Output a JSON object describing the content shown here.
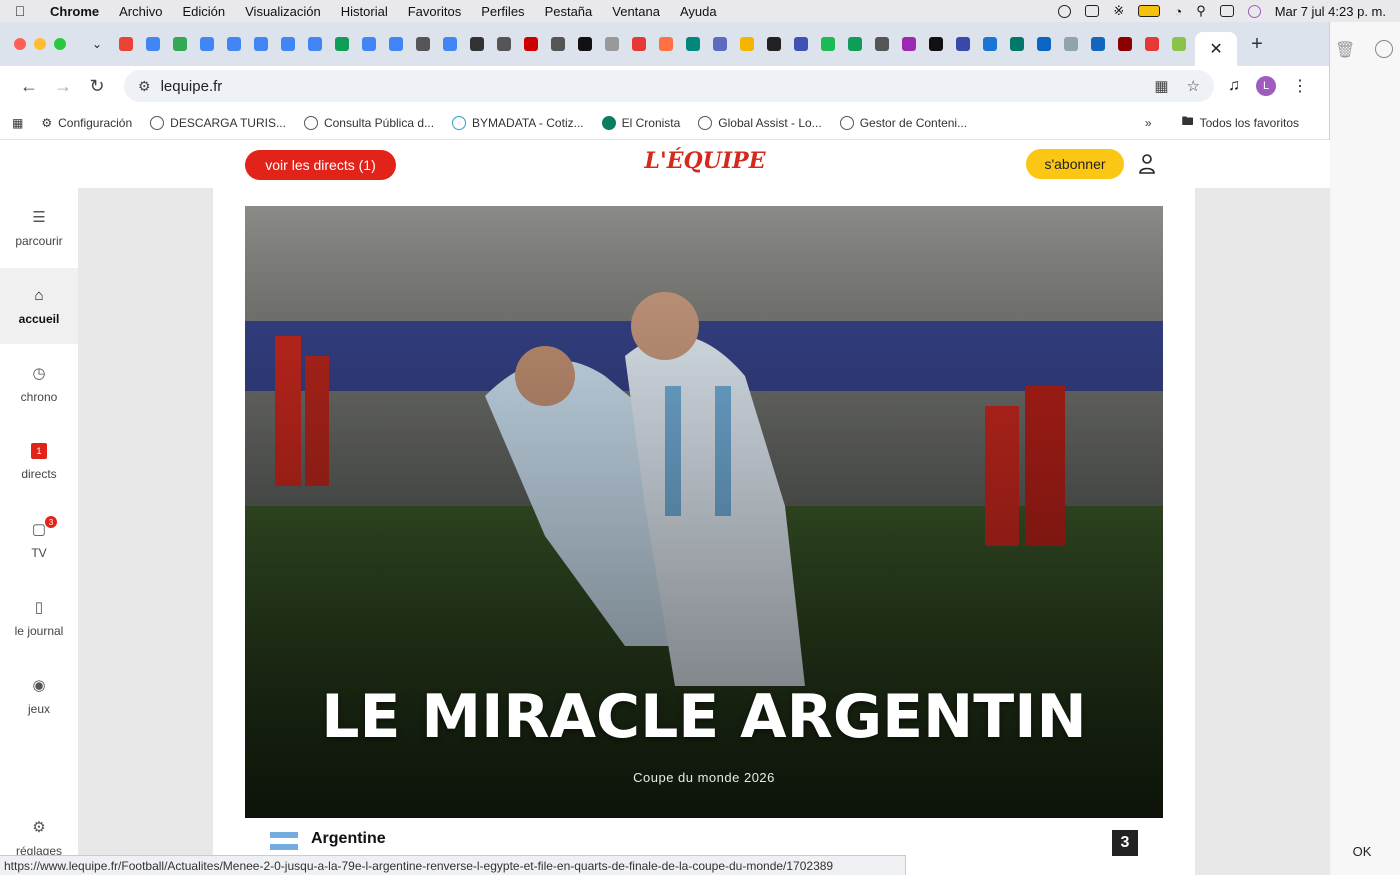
{
  "menubar": {
    "app": "Chrome",
    "items": [
      "Archivo",
      "Edición",
      "Visualización",
      "Historial",
      "Favoritos",
      "Perfiles",
      "Pestaña",
      "Ventana",
      "Ayuda"
    ],
    "clock": "Mar 7 jul  4:23 p. m."
  },
  "browser": {
    "url": "lequipe.fr",
    "profile_initial": "L",
    "tab_colors": [
      "#ea4335",
      "#4285f4",
      "#34a853",
      "#4285f4",
      "#4285f4",
      "#4285f4",
      "#4285f4",
      "#4285f4",
      "#0f9d58",
      "#4285f4",
      "#4285f4",
      "#555",
      "#4285f4",
      "#333",
      "#555",
      "#c00",
      "#555",
      "#111",
      "#999",
      "#e53935",
      "#ff7043",
      "#00897b",
      "#5c6bc0",
      "#f4b400",
      "#222",
      "#3f51b5",
      "#1db954",
      "#0f9d58",
      "#555",
      "#9c27b0",
      "#111",
      "#3949ab",
      "#1976d2",
      "#00796b",
      "#0a66c2",
      "#90a4ae",
      "#1565c0",
      "#8b0000",
      "#e53935",
      "#8bc34a"
    ],
    "bookmarks": [
      "Configuración",
      "DESCARGA TURIS...",
      "Consulta Pública d...",
      "BYMADATA - Cotiz...",
      "El Cronista",
      "Global Assist - Lo...",
      "Gestor de Conteni..."
    ],
    "all_bookmarks": "Todos los favoritos",
    "status_url": "https://www.lequipe.fr/Football/Actualites/Menee-2-0-jusqu-a-la-79e-l-argentine-renverse-l-egypte-et-file-en-quarts-de-finale-de-la-coupe-du-monde/1702389"
  },
  "site": {
    "live_button": "voir les directs (1)",
    "logo": "L'ÉQUIPE",
    "subscribe_button": "s'abonner",
    "sidebar": [
      {
        "label": "parcourir",
        "icon": "browse-icon"
      },
      {
        "label": "accueil",
        "icon": "home-icon"
      },
      {
        "label": "chrono",
        "icon": "clock-icon"
      },
      {
        "label": "directs",
        "icon": "live-icon",
        "badge": "1"
      },
      {
        "label": "TV",
        "icon": "tv-icon",
        "badge": "3"
      },
      {
        "label": "le journal",
        "icon": "newspaper-icon"
      },
      {
        "label": "jeux",
        "icon": "games-icon"
      },
      {
        "label": "réglages",
        "icon": "settings-icon"
      }
    ]
  },
  "article": {
    "headline": "LE MIRACLE ARGENTIN",
    "subtitle": "Coupe du monde 2026",
    "team": "Argentine",
    "score": "3"
  },
  "outside": {
    "ok": "OK"
  }
}
